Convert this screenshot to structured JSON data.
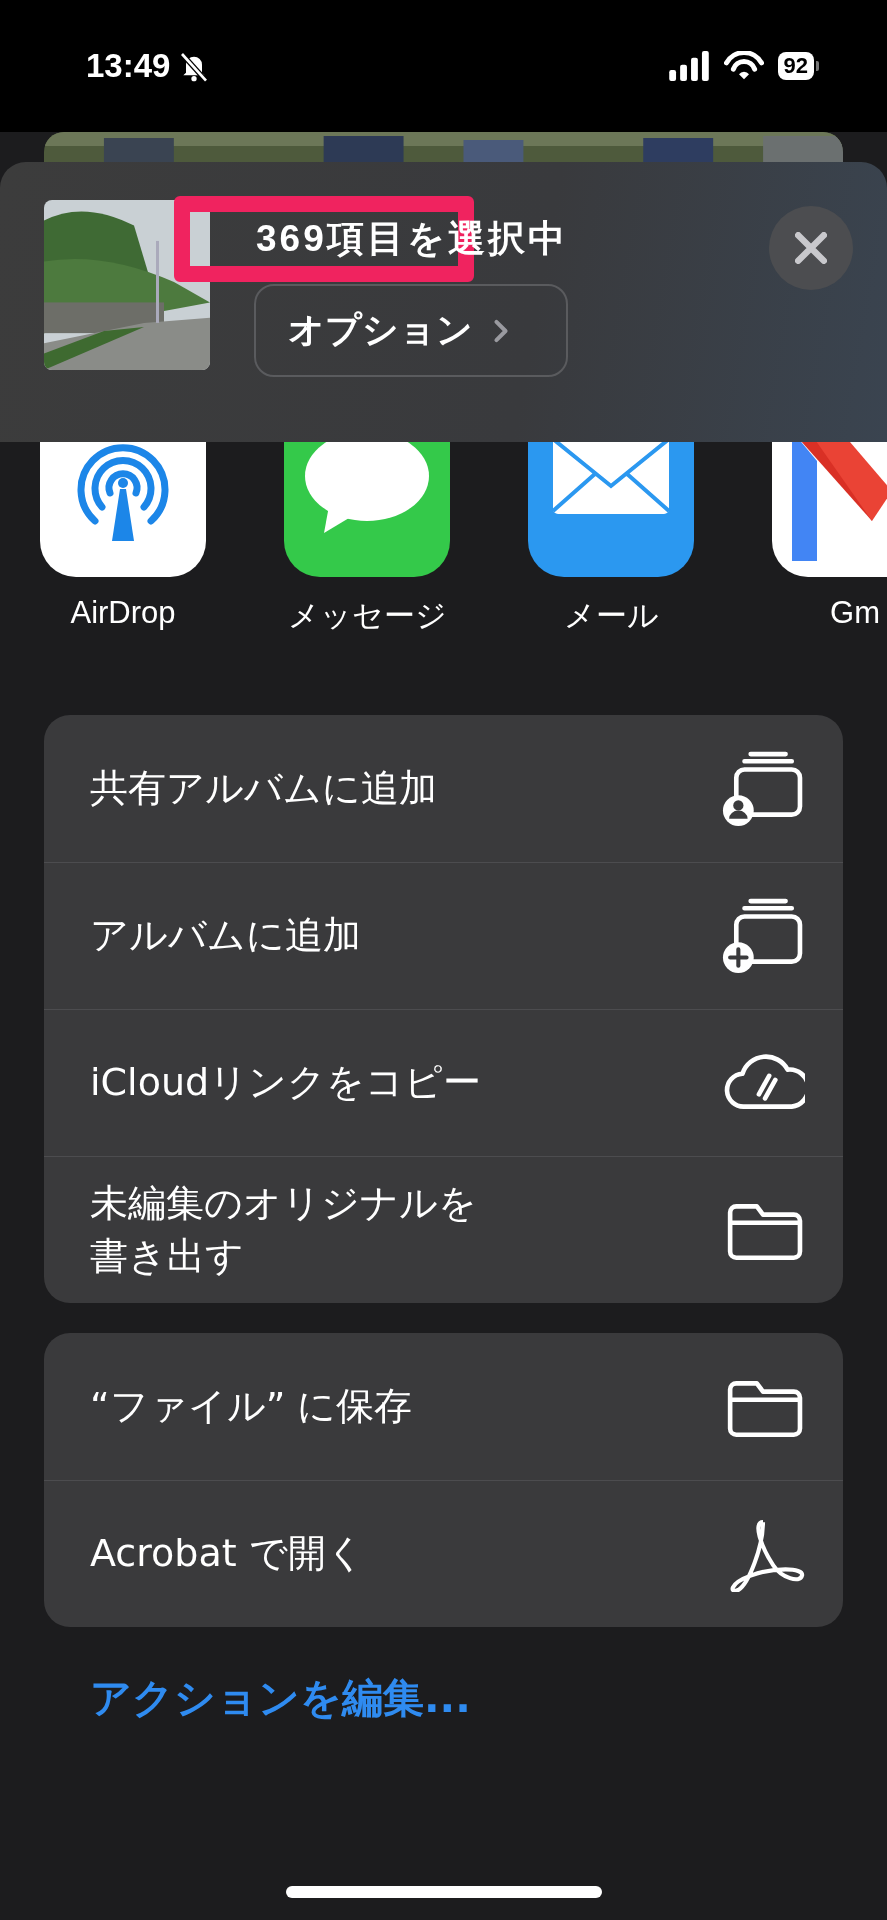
{
  "status_bar": {
    "time": "13:49",
    "silent": true,
    "battery": "92"
  },
  "header": {
    "title": "369項目を選択中",
    "highlight": true,
    "options_button": "オプション"
  },
  "apps": [
    {
      "kind": "airdrop",
      "label": "AirDrop"
    },
    {
      "kind": "messages",
      "label": "メッセージ"
    },
    {
      "kind": "mail",
      "label": "メール"
    },
    {
      "kind": "gmail",
      "label": "Gm"
    }
  ],
  "action_groups": [
    [
      {
        "kind": "shared-album",
        "label": "共有アルバムに追加"
      },
      {
        "kind": "album",
        "label": "アルバムに追加"
      },
      {
        "kind": "cloud-link",
        "label": "iCloudリンクをコピー"
      },
      {
        "kind": "folder",
        "label": "未編集のオリジナルを書き出す"
      }
    ],
    [
      {
        "kind": "folder",
        "label": "“ファイル” に保存"
      },
      {
        "kind": "acrobat",
        "label": "Acrobat で開く"
      }
    ]
  ],
  "edit_actions": "アクションを編集..."
}
